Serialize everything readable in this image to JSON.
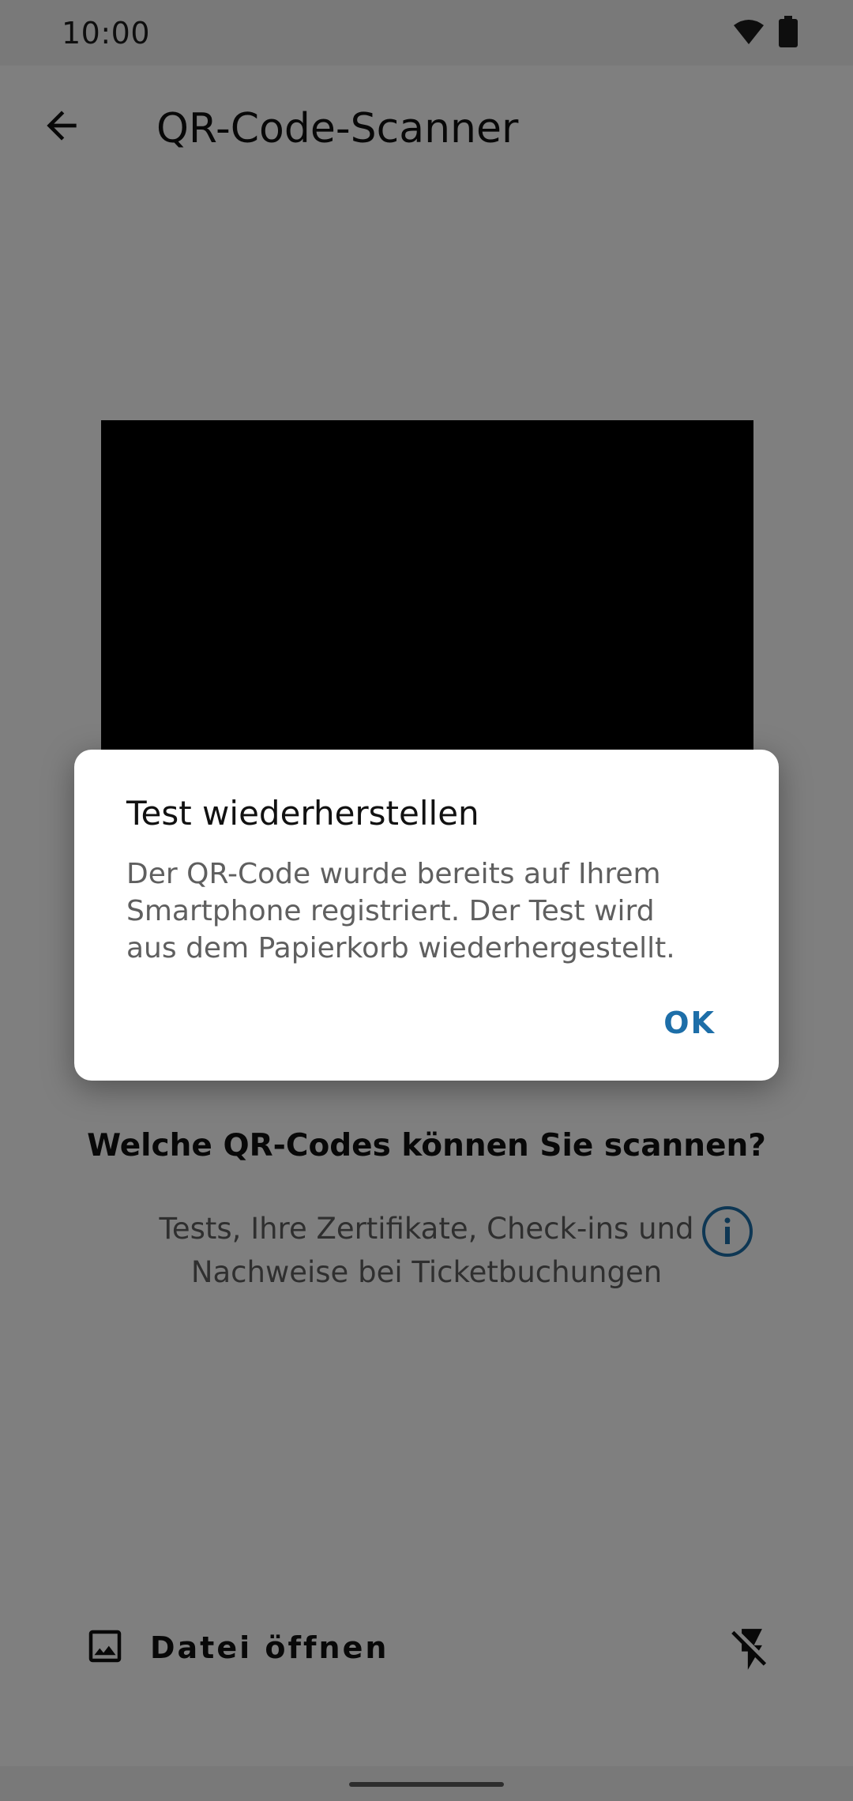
{
  "status_bar": {
    "time": "10:00"
  },
  "app_bar": {
    "title": "QR-Code-Scanner"
  },
  "info": {
    "heading": "Welche QR-Codes können Sie scannen?",
    "text": "Tests, Ihre Zertifikate, Check-ins und Nachweise bei Ticketbuchungen"
  },
  "bottom": {
    "open_file_label": "Datei öffnen"
  },
  "dialog": {
    "title": "Test wiederherstellen",
    "message": "Der QR-Code wurde bereits auf Ihrem\nSmartphone registriert.  Der Test wird\naus dem Papierkorb wiederhergestellt.",
    "ok_label": "OK"
  },
  "colors": {
    "accent": "#1d6ea8",
    "scrim": "rgba(0,0,0,0.5)"
  },
  "icons": [
    "wifi-icon",
    "battery-icon",
    "back-arrow-icon",
    "info-icon",
    "image-icon",
    "flash-off-icon"
  ]
}
